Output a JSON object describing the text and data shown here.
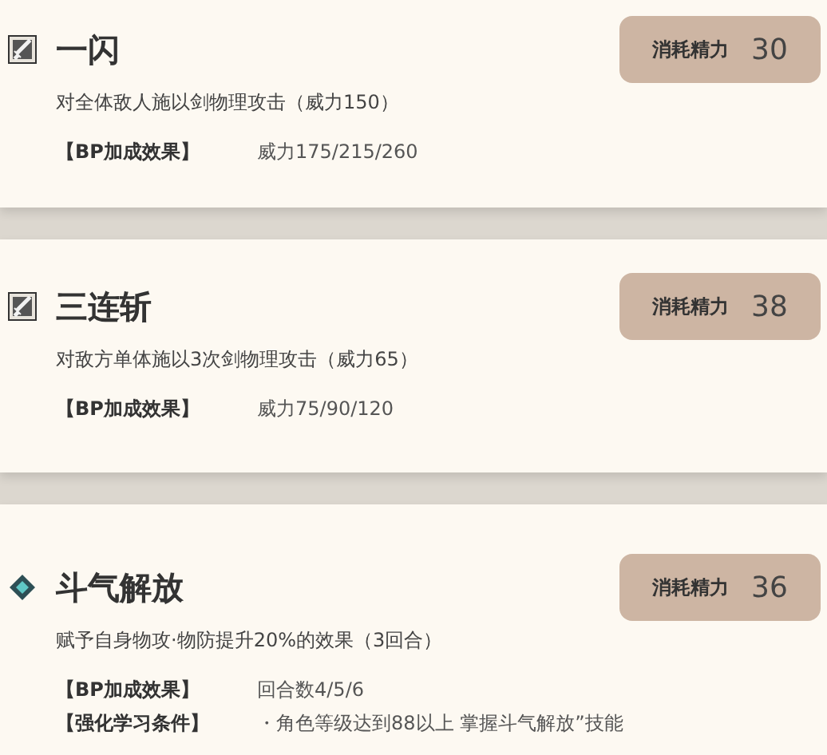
{
  "skills": [
    {
      "kind": "sword",
      "name": "一闪",
      "cost_label": "消耗精力",
      "cost": "30",
      "description": "对全体敌人施以剑物理攻击（威力150）",
      "effects": [
        {
          "label": "【BP加成效果】",
          "value": "威力175/215/260"
        }
      ]
    },
    {
      "kind": "sword",
      "name": "三连斩",
      "cost_label": "消耗精力",
      "cost": "38",
      "description": "对敌方单体施以3次剑物理攻击（威力65）",
      "effects": [
        {
          "label": "【BP加成效果】",
          "value": "威力75/90/120"
        }
      ]
    },
    {
      "kind": "buff",
      "name": "斗气解放",
      "cost_label": "消耗精力",
      "cost": "36",
      "description": "赋予自身物攻·物防提升20%的效果（3回合）",
      "effects": [
        {
          "label": "【BP加成效果】",
          "value": "回合数4/5/6"
        },
        {
          "label": "【强化学习条件】",
          "value": "・角色等级达到88以上 掌握斗气解放”技能"
        }
      ]
    }
  ]
}
